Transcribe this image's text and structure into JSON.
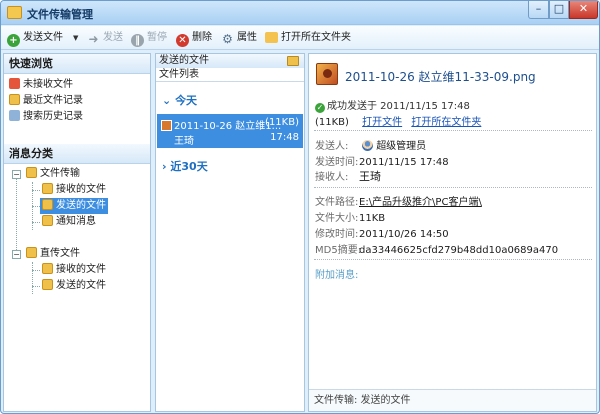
{
  "window": {
    "title": "文件传输管理",
    "buttons": {
      "min": "–",
      "max": "□",
      "close": "✕"
    }
  },
  "toolbar": {
    "items": [
      {
        "label": "发送文件",
        "icon": "plus-icon",
        "enabled": true
      },
      {
        "label": "发送",
        "icon": "send-arrow-icon",
        "enabled": false
      },
      {
        "label": "暂停",
        "icon": "pause-icon",
        "enabled": false
      },
      {
        "label": "删除",
        "icon": "delete-icon",
        "enabled": true
      },
      {
        "label": "属性",
        "icon": "gear-icon",
        "enabled": true
      },
      {
        "label": "打开所在文件夹",
        "icon": "open-folder-icon",
        "enabled": true
      }
    ],
    "dropdown_arrow": "▼"
  },
  "quick_browse": {
    "title": "快速浏览",
    "items": [
      "未接收文件",
      "最近文件记录",
      "搜索历史记录"
    ]
  },
  "categories": {
    "title": "消息分类",
    "tree": [
      {
        "label": "文件传输",
        "children": [
          "接收的文件",
          "发送的文件",
          "通知消息"
        ]
      },
      {
        "label": "直传文件",
        "children": [
          "接收的文件",
          "发送的文件"
        ]
      }
    ],
    "toggle": "−"
  },
  "file_list": {
    "header": "发送的文件",
    "subheader": "文件列表",
    "groups": [
      "今天",
      "近30天"
    ],
    "group_prefix": {
      "expanded": "⌄",
      "collapsed": "›"
    },
    "selected_row": {
      "date_name": "2011-10-26 赵立维1...",
      "size": "(11KB)",
      "recipient": "王琦",
      "time": "17:48"
    }
  },
  "detail": {
    "filename": "2011-10-26 赵立维11-33-09.png",
    "status": "成功发送于 2011/11/15 17:48",
    "size_short": "(11KB)",
    "open_file": "打开文件",
    "open_folder": "打开所在文件夹",
    "sender_label": "发送人:",
    "sender": "超级管理员",
    "send_time_label": "发送时间:",
    "send_time": "2011/11/15 17:48",
    "receiver_label": "接收人:",
    "receiver": "王琦",
    "path_label": "文件路径:",
    "path": "E:\\产品升级推介\\PC客户端\\",
    "filesize_label": "文件大小:",
    "filesize": "11KB",
    "modified_label": "修改时间:",
    "modified": "2011/10/26 14:50",
    "md5_label": "MD5摘要:",
    "md5": "da33446625cfd279b48dd10a0689a470",
    "extra_label": "附加消息:",
    "footer": "文件传输: 发送的文件"
  }
}
